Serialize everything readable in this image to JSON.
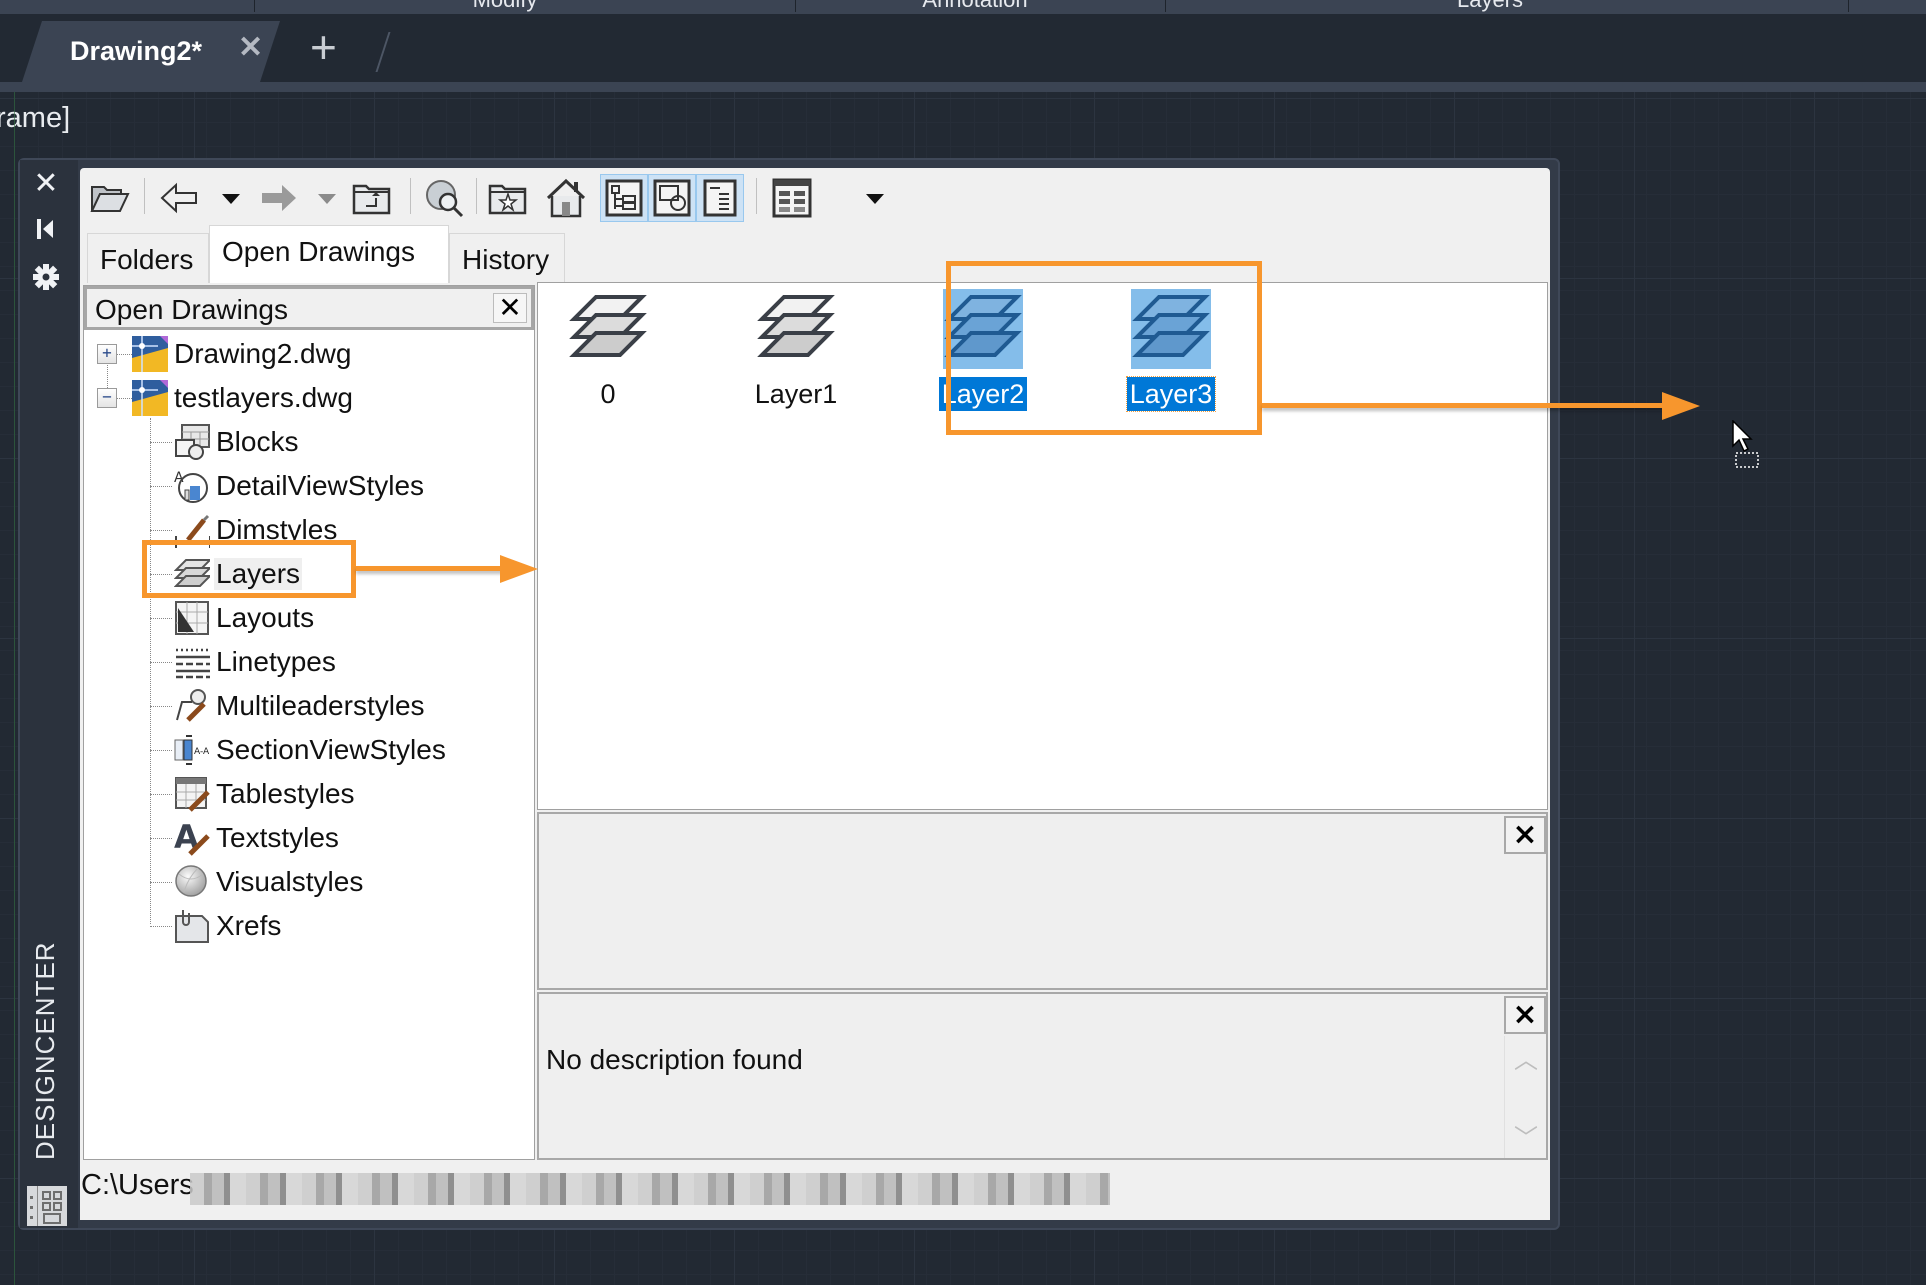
{
  "ribbon": {
    "panels": [
      "Modify",
      "Annotation",
      "Layers"
    ]
  },
  "doc_tabs": {
    "active_tab": "Drawing2*",
    "close_icon": "close-icon",
    "new_tab_icon": "plus-icon"
  },
  "command_line_fragment": "rame]",
  "palette": {
    "title": "DESIGNCENTER",
    "strip_icons": [
      "close-icon",
      "auto-hide-icon",
      "properties-gear-icon",
      "designcenter-grid-icon"
    ],
    "toolbar": {
      "buttons": [
        {
          "name": "load",
          "icon": "open-folder-icon",
          "active": false
        },
        {
          "name": "back",
          "icon": "back-arrow-icon",
          "active": false
        },
        {
          "name": "back-dropdown",
          "icon": "dropdown-arrow-icon",
          "active": false
        },
        {
          "name": "forward",
          "icon": "forward-arrow-icon",
          "active": false,
          "disabled": true
        },
        {
          "name": "forward-dropdown",
          "icon": "dropdown-arrow-icon",
          "active": false,
          "disabled": true
        },
        {
          "name": "up",
          "icon": "up-folder-icon",
          "active": false
        },
        {
          "name": "search",
          "icon": "search-globe-icon",
          "active": false
        },
        {
          "name": "favorites",
          "icon": "favorites-folder-icon",
          "active": false
        },
        {
          "name": "home",
          "icon": "home-icon",
          "active": false
        },
        {
          "name": "tree-view-toggle",
          "icon": "tree-view-icon",
          "active": true
        },
        {
          "name": "preview",
          "icon": "preview-icon",
          "active": true
        },
        {
          "name": "description",
          "icon": "description-icon",
          "active": true
        },
        {
          "name": "views",
          "icon": "views-grid-icon",
          "active": false
        },
        {
          "name": "views-dropdown",
          "icon": "dropdown-arrow-icon",
          "active": false
        }
      ]
    },
    "tabs": [
      {
        "label": "Folders",
        "active": false
      },
      {
        "label": "Open Drawings",
        "active": true
      },
      {
        "label": "History",
        "active": false
      }
    ],
    "tree": {
      "header": "Open Drawings",
      "drawings": [
        {
          "label": "Drawing2.dwg",
          "expanded": false,
          "expander": "+"
        },
        {
          "label": "testlayers.dwg",
          "expanded": true,
          "expander": "−"
        }
      ],
      "children": [
        {
          "label": "Blocks",
          "icon": "blocks-icon"
        },
        {
          "label": "DetailViewStyles",
          "icon": "detail-view-styles-icon"
        },
        {
          "label": "Dimstyles",
          "icon": "dimstyles-icon"
        },
        {
          "label": "Layers",
          "icon": "layers-icon",
          "selected": true
        },
        {
          "label": "Layouts",
          "icon": "layouts-icon"
        },
        {
          "label": "Linetypes",
          "icon": "linetypes-icon"
        },
        {
          "label": "Multileaderstyles",
          "icon": "multileader-styles-icon"
        },
        {
          "label": "SectionViewStyles",
          "icon": "section-view-styles-icon"
        },
        {
          "label": "Tablestyles",
          "icon": "table-styles-icon"
        },
        {
          "label": "Textstyles",
          "icon": "text-styles-icon"
        },
        {
          "label": "Visualstyles",
          "icon": "visual-styles-icon"
        },
        {
          "label": "Xrefs",
          "icon": "xrefs-icon"
        }
      ]
    },
    "content": {
      "layers": [
        {
          "label": "0",
          "selected": false
        },
        {
          "label": "Layer1",
          "selected": false
        },
        {
          "label": "Layer2",
          "selected": true
        },
        {
          "label": "Layer3",
          "selected": true,
          "focused": true
        }
      ]
    },
    "preview_close": "×",
    "description": {
      "text": "No description found",
      "close": "×"
    },
    "status_path": "C:\\Users"
  },
  "annotations": {
    "color": "#f7962d"
  }
}
